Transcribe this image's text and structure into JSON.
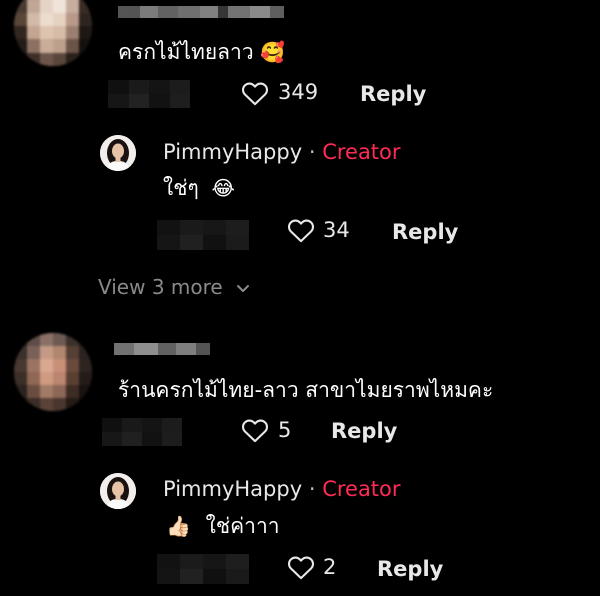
{
  "comments": [
    {
      "text": "ครกไม้ไทยลาว",
      "emoji": "🥰",
      "likes": "349",
      "reply_label": "Reply",
      "reply": {
        "author": "PimmyHappy",
        "separator": "·",
        "badge": "Creator",
        "text": "ใช่ๆ",
        "emoji": "😂",
        "likes": "34",
        "reply_label": "Reply"
      },
      "view_more": "View 3 more"
    },
    {
      "text": "ร้านครกไม้ไทย-ลาว สาขาไมยราพไหมคะ",
      "likes": "5",
      "reply_label": "Reply",
      "reply": {
        "author": "PimmyHappy",
        "separator": "·",
        "badge": "Creator",
        "emoji": "👍🏻",
        "text": "ใช่ค่าาา",
        "likes": "2",
        "reply_label": "Reply"
      }
    }
  ],
  "colors": {
    "background": "#000000",
    "creator": "#fe2c55",
    "muted": "#8a8a8a"
  },
  "icons": {
    "like": "heart-outline-icon",
    "expand": "chevron-down-icon"
  }
}
